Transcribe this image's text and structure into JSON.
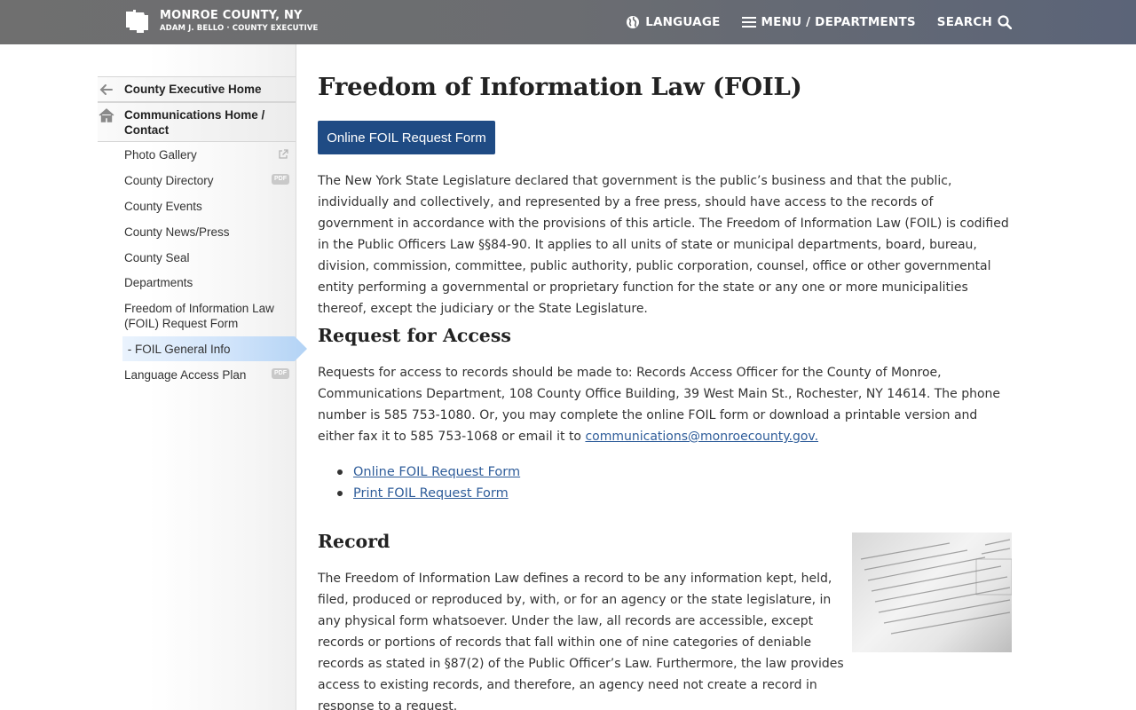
{
  "header": {
    "brand_title": "MONROE COUNTY, NY",
    "brand_subtitle": "ADAM J. BELLO · COUNTY EXECUTIVE",
    "language_label": "LANGUAGE",
    "menu_label": "MENU / DEPARTMENTS",
    "search_label": "SEARCH"
  },
  "sidebar": {
    "back_item": "County Executive Home",
    "home_item": "Communications Home / Contact",
    "items": [
      {
        "label": "Photo Gallery",
        "badge": ""
      },
      {
        "label": "County Directory",
        "badge": "PDF"
      },
      {
        "label": "County Events",
        "badge": ""
      },
      {
        "label": "County News/Press",
        "badge": ""
      },
      {
        "label": "County Seal",
        "badge": ""
      },
      {
        "label": "Departments",
        "badge": ""
      },
      {
        "label": "Freedom of Information Law (FOIL) Request Form",
        "badge": ""
      },
      {
        "label": " - FOIL General Info",
        "badge": ""
      },
      {
        "label": "Language Access Plan",
        "badge": "PDF"
      }
    ]
  },
  "main": {
    "title": "Freedom of Information Law (FOIL)",
    "request_button": "Online FOIL Request Form",
    "intro": "The New York State Legislature declared that government is the public’s business and that the public, individually and collectively, and represented by a free press, should have access to the records of government in accordance with the provisions of this article. The Freedom of Information Law (FOIL) is codified in the Public Officers Law §§84-90. It applies to all units of state or municipal departments, board, bureau, division, commission, committee, public authority, public corporation, counsel, office or other governmental entity performing a governmental or proprietary function for the state or any one or more municipalities thereof, except the judiciary or the State Legislature.",
    "access_heading": "Request for Access",
    "access_text": "Requests for access to records should be made to: Records Access Officer for the County of Monroe, Communications Department, 108 County Office Building, 39 West Main St., Rochester, NY 14614. The phone number is 585 753-1080. Or, you may complete the online FOIL form or download a printable version and either fax it to 585 753-1068 or email it to ",
    "access_email": "communications@monroecounty.gov.",
    "links": [
      "Online FOIL Request Form",
      "Print FOIL Request Form"
    ],
    "record_heading": "Record",
    "record_text": "The Freedom of Information Law defines a record to be any information kept, held, filed, produced or reproduced by, with, or for an agency or the state legislature, in any physical form whatsoever. Under the law, all records are accessible, except records or portions of records that fall within one of nine categories of deniable records as stated in §87(2) of the Public Officer’s Law. Furthermore, the law provides access to existing records, and therefore, an agency need not create a record in response to a request."
  },
  "colors": {
    "header_bg": "#6b6d71",
    "button_bg": "#1f4b84",
    "link": "#2f5d9a",
    "active_nav": "#cfe3fa"
  }
}
